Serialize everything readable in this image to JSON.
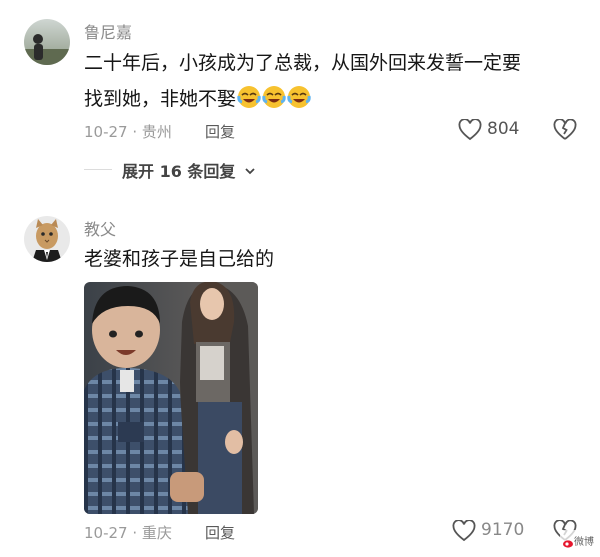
{
  "comments": [
    {
      "username": "鲁尼嘉",
      "text_line1": "二十年后，小孩成为了总裁，从国外回来发誓一定要",
      "text_line2": "找到她，非她不娶",
      "emoji_count": 3,
      "date": "10-27 · 贵州",
      "reply_label": "回复",
      "likes": "804",
      "expand_label": "展开 16 条回复"
    },
    {
      "username": "教父",
      "text": "老婆和孩子是自己给的",
      "date": "10-27 · 重庆",
      "reply_label": "回复",
      "likes": "9170"
    }
  ],
  "watermark": "微博"
}
